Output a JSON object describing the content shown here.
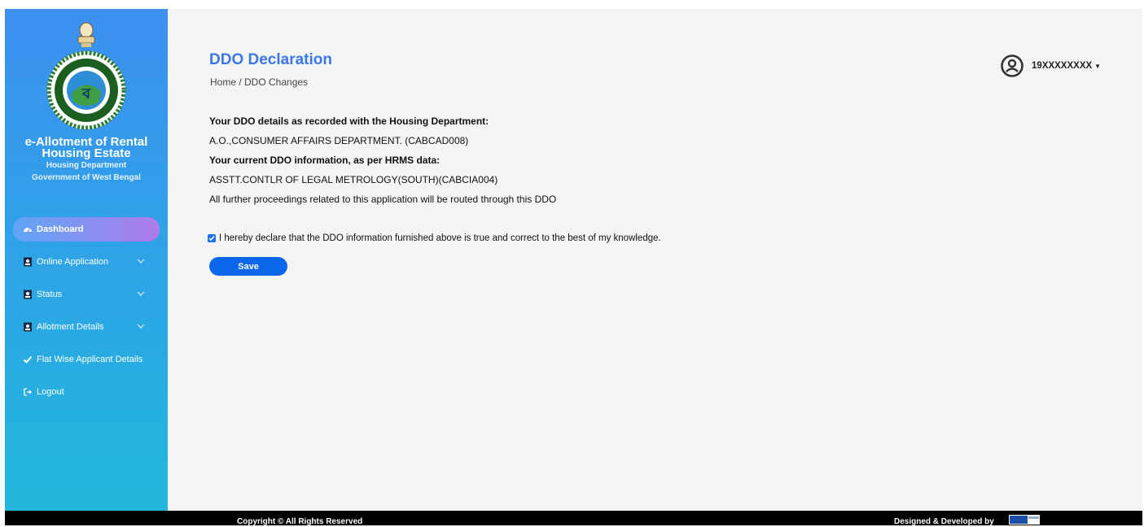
{
  "sidebar": {
    "brand_title": "e-Allotment of Rental Housing Estate",
    "department": "Housing Department",
    "government": "Government of West Bengal",
    "items": [
      {
        "label": "Dashboard",
        "icon": "dashboard-icon",
        "active": true
      },
      {
        "label": "Online Application",
        "icon": "document-icon",
        "expandable": true
      },
      {
        "label": "Status",
        "icon": "document-icon",
        "expandable": true
      },
      {
        "label": "Allotment Details",
        "icon": "document-icon",
        "expandable": true
      },
      {
        "label": "Flat Wise Applicant Details",
        "icon": "check-icon"
      },
      {
        "label": "Logout",
        "icon": "logout-icon"
      }
    ]
  },
  "header": {
    "title": "DDO Declaration",
    "breadcrumb": "Home / DDO Changes",
    "user": "19XXXXXXXX"
  },
  "main": {
    "housing_heading": "Your DDO details as recorded with the Housing Department:",
    "housing_value": "A.O.,CONSUMER AFFAIRS DEPARTMENT. (CABCAD008)",
    "hrms_heading": "Your current DDO information, as per HRMS data:",
    "hrms_value": "ASSTT.CONTLR OF LEGAL METROLOGY(SOUTH)(CABCIA004)",
    "note": "All further proceedings related to this application will be routed through this DDO",
    "declaration": "I hereby declare that the DDO information furnished above is true and correct to the best of my knowledge.",
    "declaration_checked": true,
    "save_label": "Save"
  },
  "footer": {
    "copyright": "Copyright © All Rights Reserved",
    "designed": "Designed & Developed by"
  },
  "colors": {
    "accent": "#3a78e6",
    "button": "#0b66ea",
    "sidebar_top": "#3d8ff0",
    "sidebar_bottom": "#22b7da"
  }
}
